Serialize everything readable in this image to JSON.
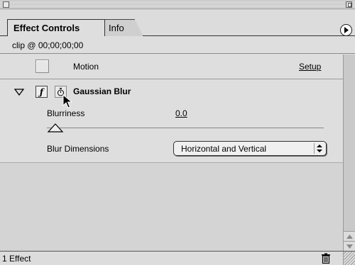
{
  "panel": {
    "tabs": [
      {
        "label": "Effect Controls",
        "active": true
      },
      {
        "label": "Info",
        "active": false
      }
    ]
  },
  "clip": {
    "label": "clip @ 00;00;00;00"
  },
  "motion": {
    "label": "Motion",
    "setup_label": "Setup",
    "enabled": false
  },
  "effect": {
    "name": "Gaussian Blur",
    "params": {
      "blurriness_label": "Blurriness",
      "blurriness_value": "0.0",
      "blur_dimensions_label": "Blur Dimensions",
      "blur_dimensions_value": "Horizontal and Vertical"
    }
  },
  "status": {
    "count_label": "1 Effect"
  },
  "icons": {
    "twist": "disclosure-triangle-icon",
    "fx": "effect-toggle-icon",
    "keyframe": "stopwatch-icon",
    "trash": "trash-icon",
    "menu": "panel-menu-icon"
  }
}
